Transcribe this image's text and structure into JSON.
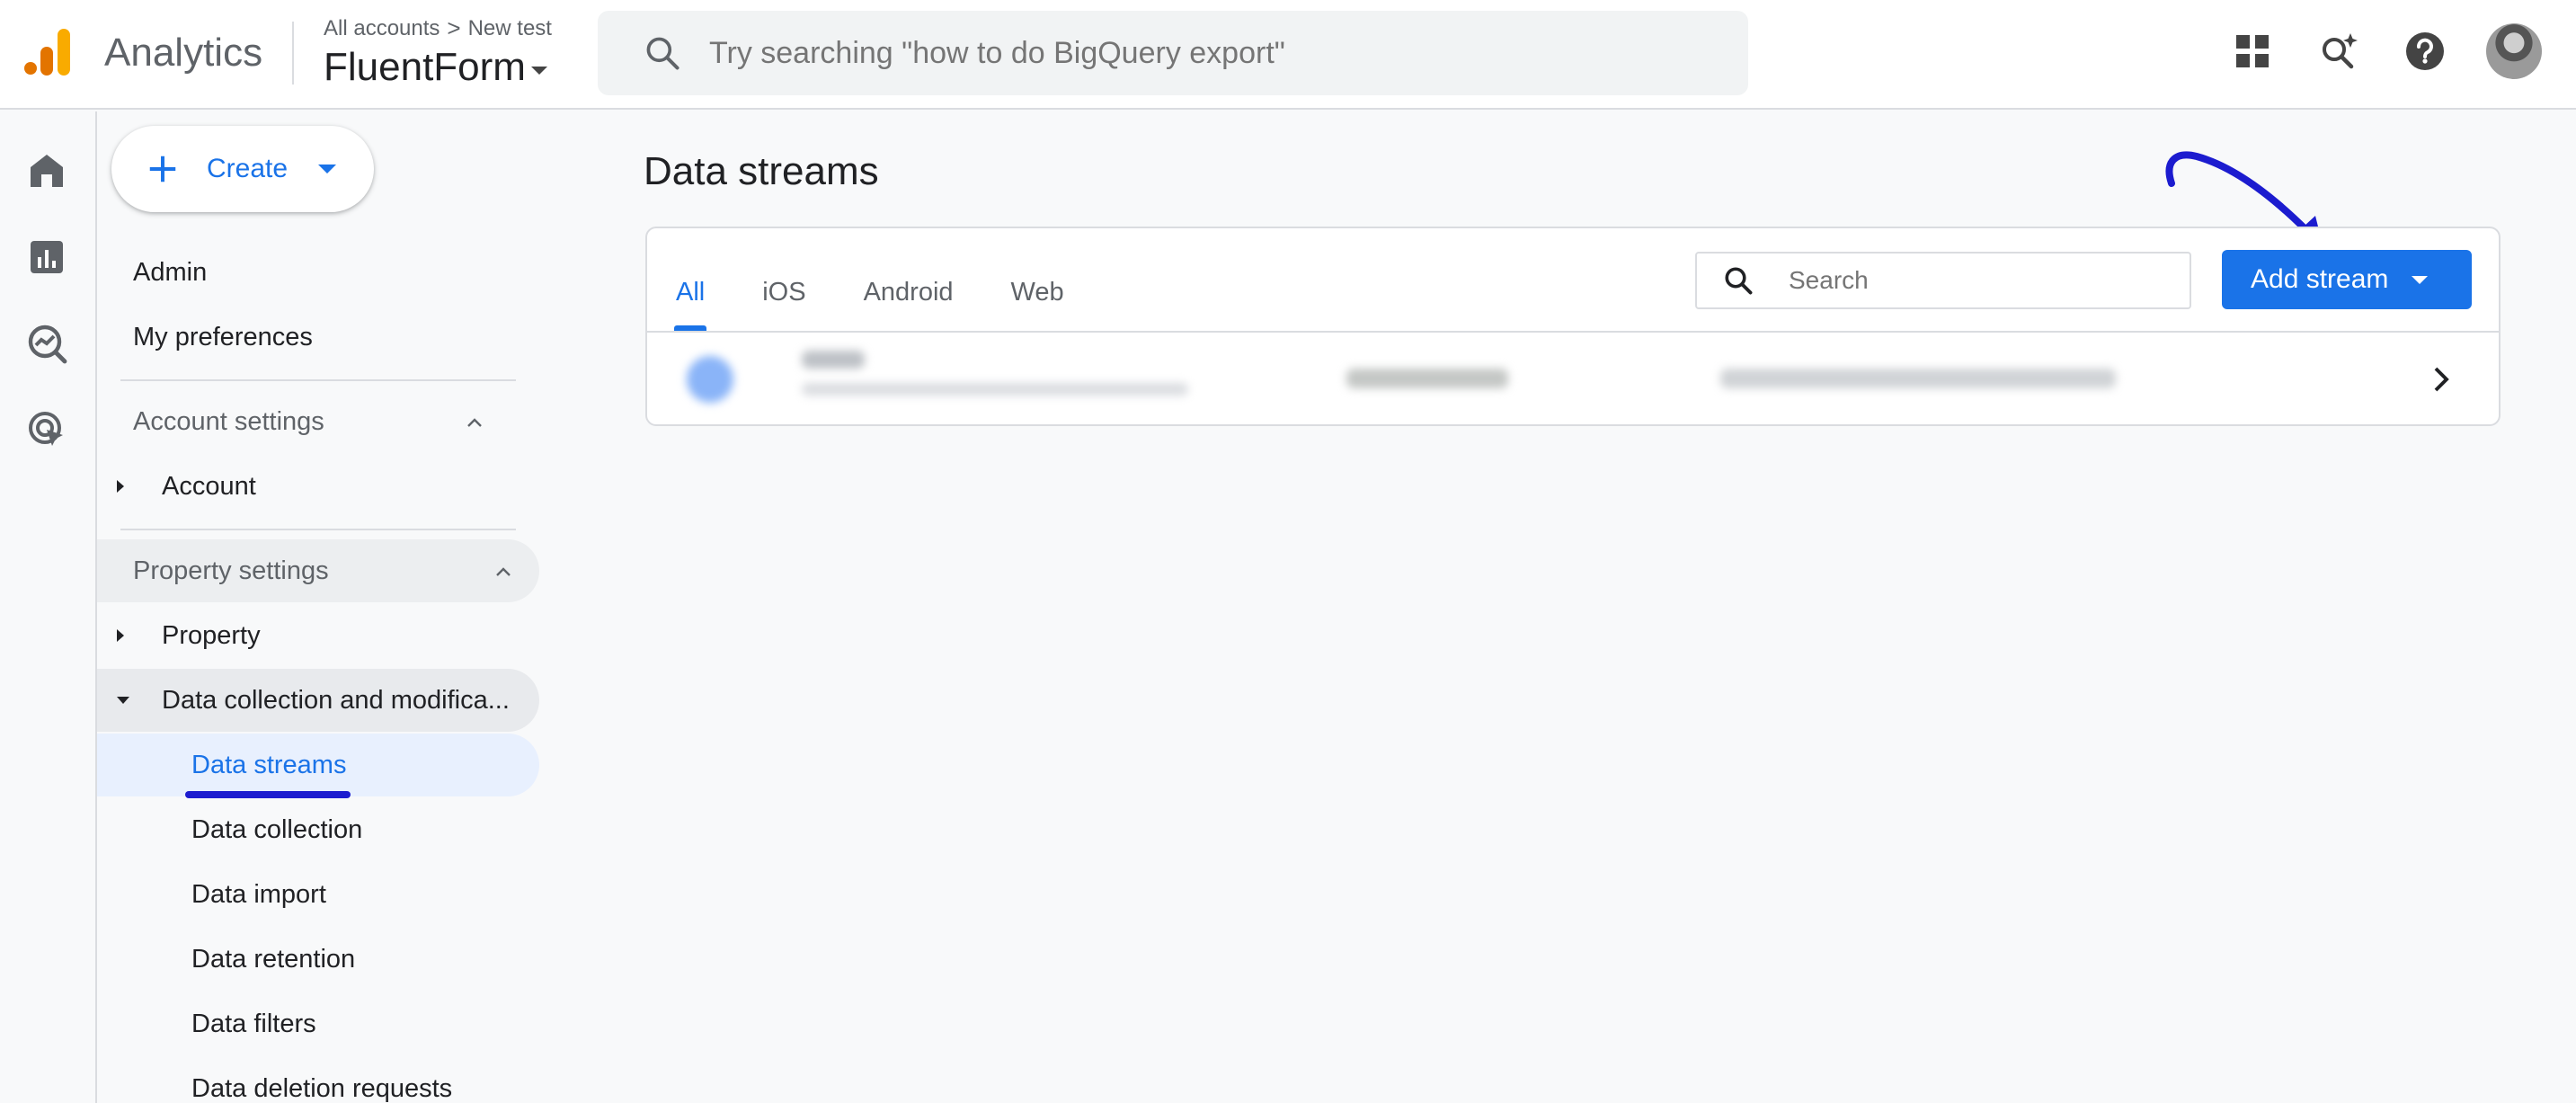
{
  "app": {
    "brand": "Analytics",
    "breadcrumb": {
      "account": "All accounts",
      "separator": ">",
      "sub": "New test"
    },
    "property_name": "FluentForm"
  },
  "search": {
    "placeholder": "Try searching \"how to do BigQuery export\""
  },
  "top_icons": [
    "apps-grid-icon",
    "search-insights-icon",
    "help-icon",
    "avatar"
  ],
  "rail": [
    "home-icon",
    "reports-icon",
    "explore-icon",
    "advertising-icon"
  ],
  "sidebar": {
    "create_label": "Create",
    "admin": "Admin",
    "my_preferences": "My preferences",
    "account_settings": {
      "title": "Account settings",
      "items": [
        "Account"
      ]
    },
    "property_settings": {
      "title": "Property settings",
      "items": [
        "Property",
        "Data collection and modifica..."
      ],
      "data_collection_children": [
        "Data streams",
        "Data collection",
        "Data import",
        "Data retention",
        "Data filters",
        "Data deletion requests"
      ]
    },
    "active_item": "Data streams"
  },
  "main": {
    "title": "Data streams",
    "tabs": [
      "All",
      "iOS",
      "Android",
      "Web"
    ],
    "active_tab": "All",
    "search_placeholder": "Search",
    "add_stream_label": "Add stream"
  },
  "colors": {
    "accent": "#1a73e8",
    "annotation": "#1c1ccf",
    "selected_bg": "#e8f0fe"
  }
}
